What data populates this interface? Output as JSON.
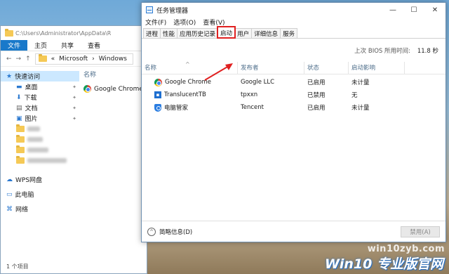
{
  "explorer": {
    "path": "C:\\Users\\Administrator\\AppData\\R",
    "ribbon": [
      "文件",
      "主页",
      "共享",
      "查看"
    ],
    "breadcrumb": [
      "«",
      "Microsoft",
      "Windows"
    ],
    "nav": [
      {
        "label": "快速访问",
        "icon": "star-icon"
      },
      {
        "label": "桌面",
        "icon": "desktop-icon"
      },
      {
        "label": "下载",
        "icon": "download-icon"
      },
      {
        "label": "文档",
        "icon": "document-icon"
      },
      {
        "label": "图片",
        "icon": "picture-icon"
      },
      {
        "label": "WPS网盘",
        "icon": "cloud-icon"
      },
      {
        "label": "此电脑",
        "icon": "computer-icon"
      },
      {
        "label": "网络",
        "icon": "network-icon"
      }
    ],
    "column_name": "名称",
    "file_name": "Google Chrome",
    "status": "1 个项目"
  },
  "taskmgr": {
    "title": "任务管理器",
    "menu": [
      "文件(F)",
      "选项(O)",
      "查看(V)"
    ],
    "tabs": [
      "进程",
      "性能",
      "应用历史记录",
      "启动",
      "用户",
      "详细信息",
      "服务"
    ],
    "active_tab": "启动",
    "bios_label": "上次 BIOS 所用时间:",
    "bios_value": "11.8 秒",
    "columns": [
      "名称",
      "发布者",
      "状态",
      "启动影响"
    ],
    "rows": [
      {
        "name": "Google Chrome",
        "publisher": "Google LLC",
        "status": "已启用",
        "impact": "未计量",
        "icon": "chrome-icon"
      },
      {
        "name": "TranslucentTB",
        "publisher": "tpxxn",
        "status": "已禁用",
        "impact": "无",
        "icon": "translucenttb-icon"
      },
      {
        "name": "电脑管家",
        "publisher": "Tencent",
        "status": "已启用",
        "impact": "未计量",
        "icon": "pc-manager-icon"
      }
    ],
    "fewer_details": "简略信息(D)",
    "disable_button": "禁用(A)"
  },
  "watermark": {
    "url": "win10zyb.com",
    "brand": "Win10 专业版官网"
  },
  "colors": {
    "accent": "#1979ca",
    "highlight": "#e02020"
  }
}
